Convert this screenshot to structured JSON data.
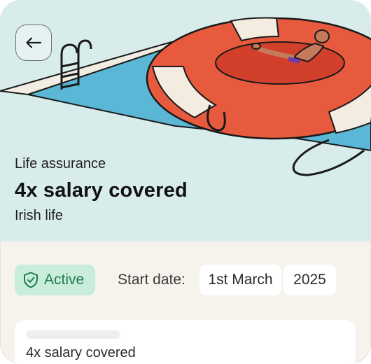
{
  "nav": {
    "back_icon": "arrow-left-icon"
  },
  "hero": {
    "category": "Life assurance",
    "headline": "4x salary covered",
    "provider": "Irish life"
  },
  "status": {
    "label": "Active",
    "icon": "shield-check-icon",
    "color": "#1f7a4f",
    "background": "#c9eddb"
  },
  "start_date": {
    "label": "Start date:",
    "day_month": "1st March",
    "year": "2025"
  },
  "summary_card": {
    "text": "4x salary covered"
  }
}
